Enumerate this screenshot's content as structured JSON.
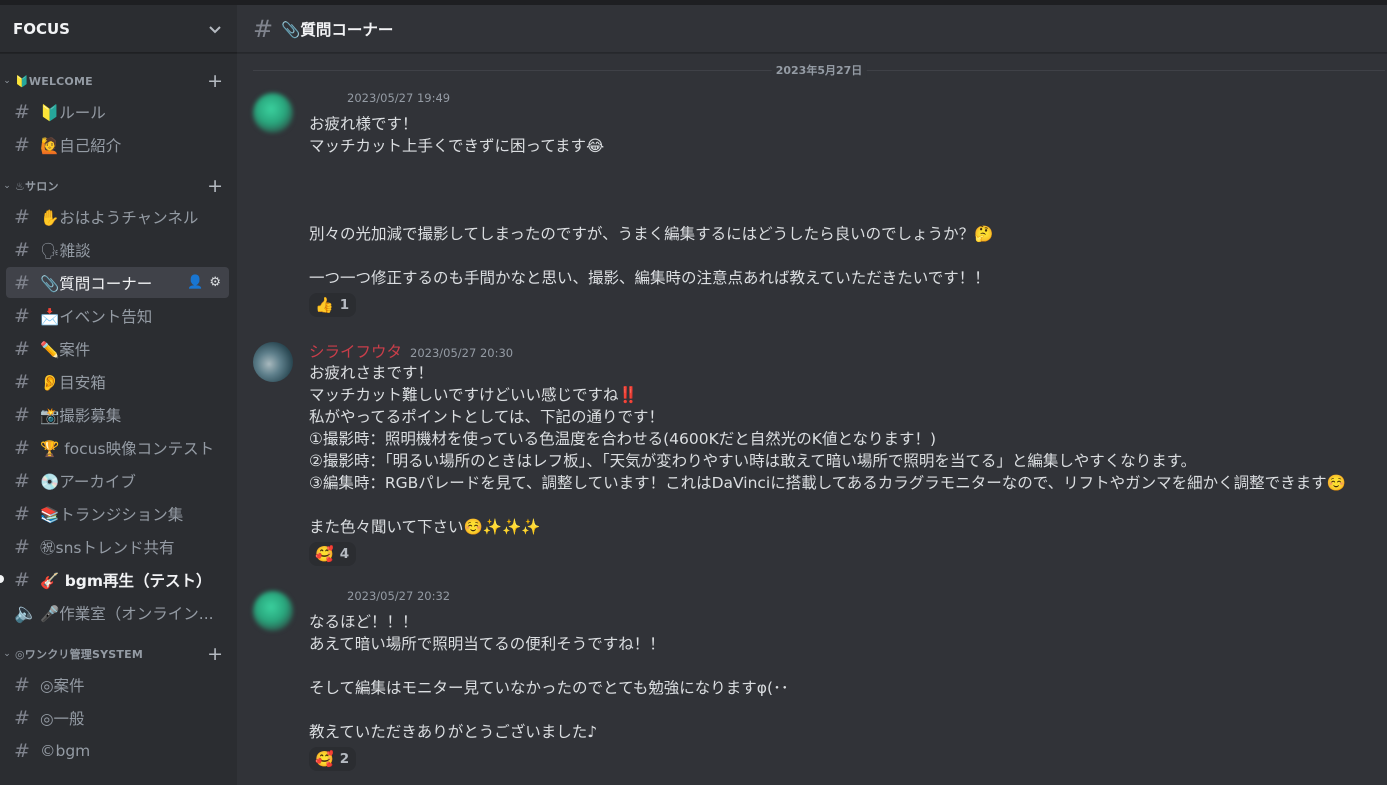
{
  "server": {
    "name": "FOCUS"
  },
  "categories": [
    {
      "label": "🔰WELCOME",
      "channels": [
        {
          "label": "🔰ルール"
        },
        {
          "label": "🙋自己紹介"
        }
      ]
    },
    {
      "label": "♨サロン",
      "channels": [
        {
          "label": "✋おはようチャンネル"
        },
        {
          "label": "🗣雑談"
        },
        {
          "label": "📎質問コーナー"
        },
        {
          "label": "📩イベント告知"
        },
        {
          "label": "✏️案件"
        },
        {
          "label": "👂目安箱"
        },
        {
          "label": "📸撮影募集"
        },
        {
          "label": "🏆 focus映像コンテスト"
        },
        {
          "label": "💿アーカイブ"
        },
        {
          "label": "📚トランジション集"
        },
        {
          "label": "㊗snsトレンド共有"
        },
        {
          "label": "🎸 bgm再生（テスト）"
        },
        {
          "label": "🎤作業室（オンライン..."
        }
      ]
    },
    {
      "label": "◎ワンクリ管理SYSTEM",
      "channels": [
        {
          "label": "◎案件"
        },
        {
          "label": "◎一般"
        },
        {
          "label": "©bgm"
        }
      ]
    }
  ],
  "channel_header": {
    "title": "📎質問コーナー"
  },
  "date_divider": "2023年5月27日",
  "messages": [
    {
      "author": "",
      "timestamp": "2023/05/27 19:49",
      "lines": [
        "お疲れ様です！",
        "マッチカット上手くできずに困ってます😂",
        "",
        "",
        "",
        "別々の光加減で撮影してしまったのですが、うまく編集するにはどうしたら良いのでしょうか？🤔",
        "",
        "一つ一つ修正するのも手間かなと思い、撮影、編集時の注意点あれば教えていただきたいです！！"
      ],
      "reaction": {
        "emoji": "👍",
        "count": "1"
      }
    },
    {
      "author": "シライフウタ",
      "timestamp": "2023/05/27 20:30",
      "lines": [
        "お疲れさまです！",
        "マッチカット難しいですけどいい感じですね‼️",
        "私がやってるポイントとしては、下記の通りです！",
        "①撮影時：照明機材を使っている色温度を合わせる(4600Kだと自然光のK値となります！)",
        "②撮影時：「明るい場所のときはレフ板」、「天気が変わりやすい時は敢えて暗い場所で照明を当てる」と編集しやすくなります。",
        "③編集時：RGBパレードを見て、調整しています！これはDaVinciに搭載してあるカラグラモニターなので、リフトやガンマを細かく調整できます☺️",
        "",
        "また色々聞いて下さい☺️✨✨✨"
      ],
      "reaction": {
        "emoji": "🥰",
        "count": "4"
      }
    },
    {
      "author": "",
      "timestamp": "2023/05/27 20:32",
      "lines": [
        "なるほど！！！",
        "あえて暗い場所で照明当てるの便利そうですね！！",
        "",
        "そして編集はモニター見ていなかったのでとても勉強になりますφ(･･",
        "",
        "教えていただきありがとうございました♪"
      ],
      "reaction": {
        "emoji": "🥰",
        "count": "2"
      }
    }
  ]
}
